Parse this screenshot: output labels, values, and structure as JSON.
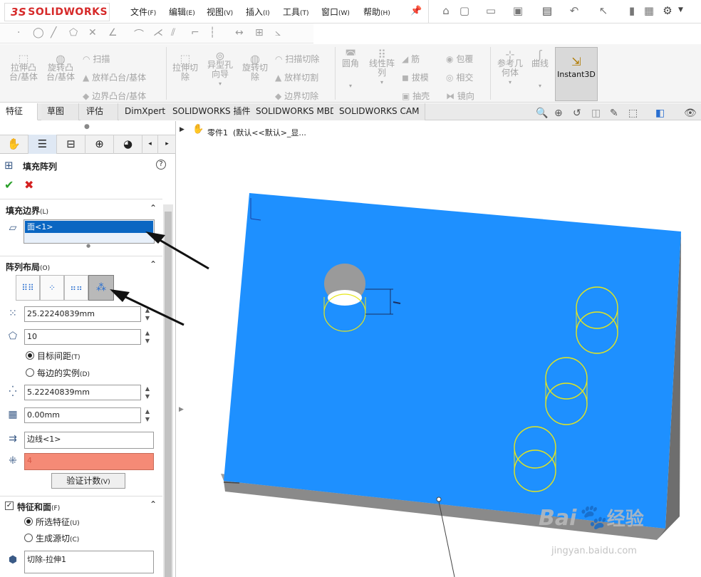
{
  "app": {
    "logo_text": "SOLIDWORKS",
    "logo_mark": "3S"
  },
  "menus": [
    {
      "label": "文件",
      "key": "(F)"
    },
    {
      "label": "编辑",
      "key": "(E)"
    },
    {
      "label": "视图",
      "key": "(V)"
    },
    {
      "label": "插入",
      "key": "(I)"
    },
    {
      "label": "工具",
      "key": "(T)"
    },
    {
      "label": "窗口",
      "key": "(W)"
    },
    {
      "label": "帮助",
      "key": "(H)"
    }
  ],
  "command_manager": {
    "groups": [
      {
        "label1": "拉伸凸",
        "label2": "台/基体"
      },
      {
        "label1": "旋转凸",
        "label2": "台/基体"
      },
      {
        "label1": "拉伸切",
        "label2": "除"
      },
      {
        "label1": "异型孔",
        "label2": "向导"
      },
      {
        "label1": "旋转切",
        "label2": "除"
      },
      {
        "label1": "圆角",
        "label2": ""
      },
      {
        "label1": "线性阵",
        "label2": "列"
      },
      {
        "label1": "参考几",
        "label2": "何体"
      },
      {
        "label1": "曲线",
        "label2": ""
      }
    ],
    "small": [
      "扫描",
      "放样凸台/基体",
      "边界凸台/基体",
      "扫描切除",
      "放样切割",
      "边界切除",
      "筋",
      "包覆",
      "拔模",
      "相交",
      "抽壳",
      "镜向"
    ],
    "instant3d": "Instant3D"
  },
  "tabs": [
    "特征",
    "草图",
    "评估",
    "DimXpert",
    "SOLIDWORKS 插件",
    "SOLIDWORKS MBD",
    "SOLIDWORKS CAM"
  ],
  "tree": {
    "label": "零件1  (默认<<默认>_显..."
  },
  "property_manager": {
    "title": "填充阵列",
    "boundary": {
      "header": "填充边界",
      "key": "(L)",
      "value": "面<1>"
    },
    "layout": {
      "header": "阵列布局",
      "key": "(O)",
      "spacing": "25.22240839mm",
      "count": "10",
      "radio1": "目标间距",
      "radio1_key": "(T)",
      "radio2": "每边的实例",
      "radio2_key": "(D)",
      "stagger": "5.22240839mm",
      "margin": "0.00mm",
      "direction": "边线<1>",
      "instances": "4",
      "verify_button": "验证计数",
      "verify_key": "(V)"
    },
    "features": {
      "header": "特征和面",
      "key": "(F)",
      "radio1": "所选特征",
      "radio1_key": "(U)",
      "radio2": "生成源切",
      "radio2_key": "(C)",
      "feature": "切除-拉伸1"
    }
  },
  "colors": {
    "face": "#1e90ff",
    "side": "#8a8a8a",
    "sketch": "#e6e61a",
    "accent": "#0a66c2"
  },
  "watermark": {
    "brand": "Bai",
    "brand_cn": "经验",
    "url": "jingyan.baidu.com"
  }
}
